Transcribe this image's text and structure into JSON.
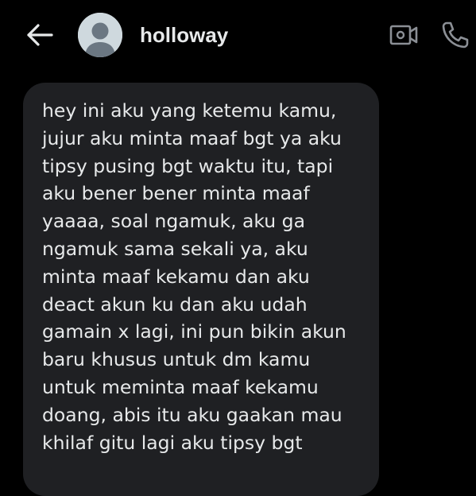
{
  "header": {
    "username": "holloway",
    "back_icon": "arrow-left-icon",
    "avatar_icon": "default-avatar-icon",
    "video_icon": "video-camera-icon",
    "call_icon": "phone-icon"
  },
  "messages": [
    {
      "text": "hey ini aku yang ketemu kamu,\njujur aku minta maaf bgt ya aku\ntipsy pusing bgt waktu itu, tapi\naku bener bener minta maaf\nyaaaa, soal ngamuk, aku ga\nngamuk sama sekali ya, aku\nminta maaf kekamu dan aku\ndeact akun ku dan aku udah\ngamain x lagi, ini pun bikin akun\nbaru khusus untuk dm kamu\nuntuk meminta maaf kekamu\ndoang, abis itu aku gaakan mau\nkhilaf gitu lagi aku tipsy bgt"
    }
  ],
  "colors": {
    "background": "#000000",
    "bubble": "#1f2023",
    "text": "#e7e9ea",
    "icon": "#e7e9ea",
    "header_icon_gray": "#8b8f95",
    "avatar_bg": "#cfd9de",
    "avatar_fg": "#6b7782"
  }
}
